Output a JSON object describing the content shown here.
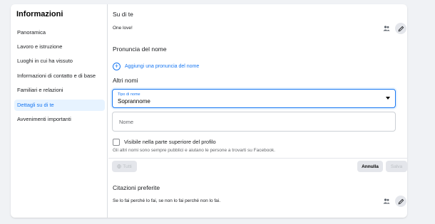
{
  "sidebar": {
    "title": "Informazioni",
    "items": [
      {
        "label": "Panoramica"
      },
      {
        "label": "Lavoro e istruzione"
      },
      {
        "label": "Luoghi in cui ha vissuto"
      },
      {
        "label": "Informazioni di contatto e di base"
      },
      {
        "label": "Familiari e relazioni"
      },
      {
        "label": "Dettagli su di te",
        "active": true
      },
      {
        "label": "Avvenimenti importanti"
      }
    ]
  },
  "about": {
    "title": "Su di te",
    "text": "One love!",
    "audience_icon": "friends-icon",
    "edit_icon": "pencil-icon"
  },
  "pronunciation": {
    "title": "Pronuncia del nome",
    "add_label": "Aggiungi una pronuncia del nome"
  },
  "other_names": {
    "title": "Altri nomi",
    "select_label": "Tipo di nome",
    "select_value": "Soprannome",
    "name_placeholder": "Nome",
    "checkbox_label": "Visibile nella parte superiore del profilo",
    "checkbox_checked": false,
    "helper_text": "Gli altri nomi sono sempre pubblici e aiutano le persone a trovarti su Facebook.",
    "audience_button": "Tutti",
    "cancel_button": "Annulla",
    "save_button": "Salva"
  },
  "quotes": {
    "title": "Citazioni preferite",
    "text": "Se lo fai perché lo fai, se non lo fai perché non lo fai.",
    "audience_icon": "friends-icon",
    "edit_icon": "pencil-icon"
  },
  "colors": {
    "accent": "#1877f2",
    "active_bg": "#e7f3ff",
    "page_bg": "#f0f2f5"
  }
}
